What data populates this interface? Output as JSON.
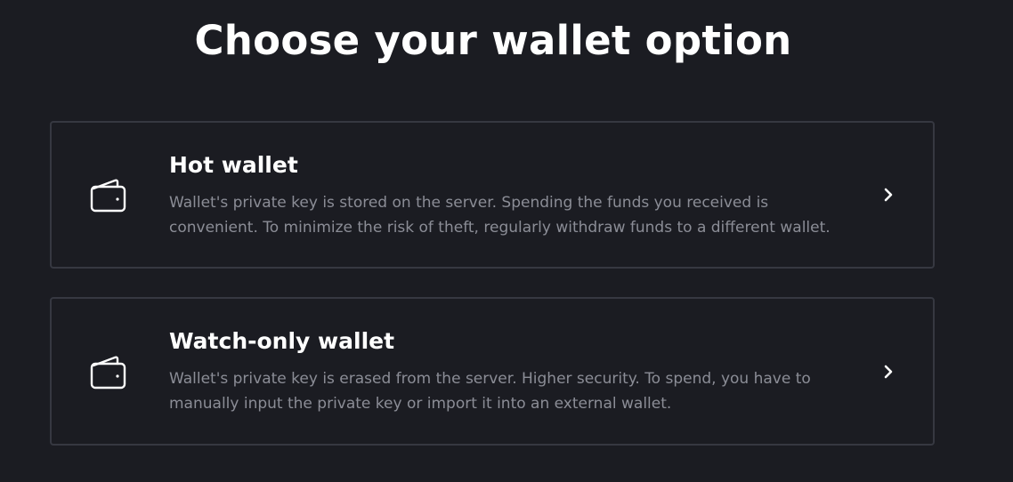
{
  "header": {
    "title": "Choose your wallet option"
  },
  "options": [
    {
      "title": "Hot wallet",
      "description": "Wallet's private key is stored on the server. Spending the funds you received is convenient. To minimize the risk of theft, regularly withdraw funds to a different wallet.",
      "icon": "wallet-icon",
      "action_icon": "chevron-right-icon"
    },
    {
      "title": "Watch-only wallet",
      "description": "Wallet's private key is erased from the server. Higher security. To spend, you have to manually input the private key or import it into an external wallet.",
      "icon": "wallet-icon",
      "action_icon": "chevron-right-icon"
    }
  ],
  "colors": {
    "background": "#1b1c22",
    "card_border": "#363841",
    "title_text": "#ffffff",
    "description_text": "#8b8d96"
  }
}
